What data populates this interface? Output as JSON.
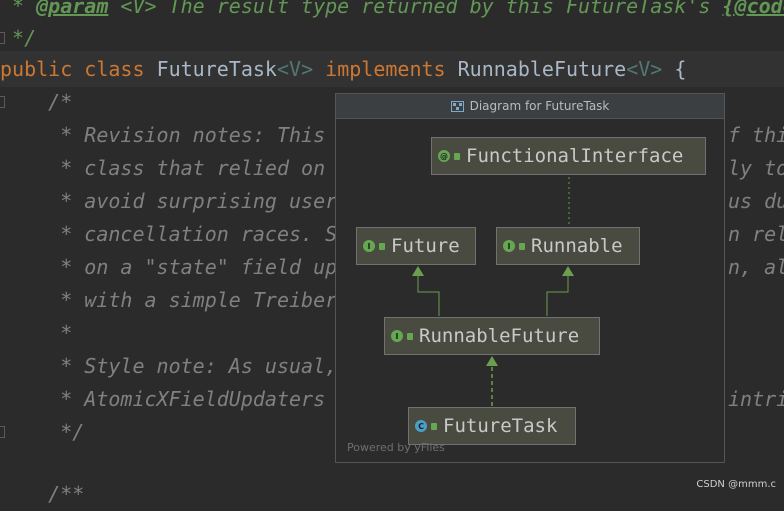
{
  "code": {
    "line_javadoc_param": {
      "prefix": " * ",
      "tag": "@param",
      "type_param": " <V>",
      "text": " The result type returned by this FutureTask's ",
      "link": "{@code"
    },
    "line_comment_close": " */",
    "line_class_decl": {
      "kw_public": "public",
      "kw_class": "class",
      "class_name": "FutureTask",
      "type_param": "<V>",
      "kw_implements": "implements",
      "iface": "RunnableFuture",
      "iface_type": "<V>",
      "brace": " {"
    },
    "comment_lines_left": [
      "    /*",
      "     * Revision notes: This",
      "     * class that relied on",
      "     * avoid surprising user",
      "     * cancellation races. S",
      "     * on a \"state\" field up",
      "     * with a simple Treiber",
      "     *",
      "     * Style note: As usual,",
      "     * AtomicXFieldUpdaters",
      "     */"
    ],
    "comment_lines_right": [
      "",
      "f thi",
      "ly to",
      "us du",
      "n rel",
      "n, al",
      "",
      "",
      "",
      "intri",
      ""
    ],
    "line_javadoc_open": "    /**"
  },
  "popup": {
    "title": "Diagram for FutureTask",
    "title_icon": "diagram-icon",
    "nodes": {
      "functional_interface": {
        "label": "FunctionalInterface",
        "badge": "@",
        "icon": "annotation-icon"
      },
      "future": {
        "label": "Future",
        "badge": "I",
        "icon": "interface-icon"
      },
      "runnable": {
        "label": "Runnable",
        "badge": "I",
        "icon": "interface-icon"
      },
      "runnable_future": {
        "label": "RunnableFuture",
        "badge": "I",
        "icon": "interface-icon"
      },
      "future_task": {
        "label": "FutureTask",
        "badge": "C",
        "icon": "class-icon"
      }
    },
    "footer": "Powered by yFiles"
  },
  "watermark": "CSDN @mmm.c",
  "colors": {
    "editor_bg": "#2b2b2b",
    "keyword": "#cc7832",
    "comment": "#808080",
    "javadoc_tag": "#629755",
    "node_bg": "#4a4b40",
    "edge": "#6a9f4f"
  }
}
